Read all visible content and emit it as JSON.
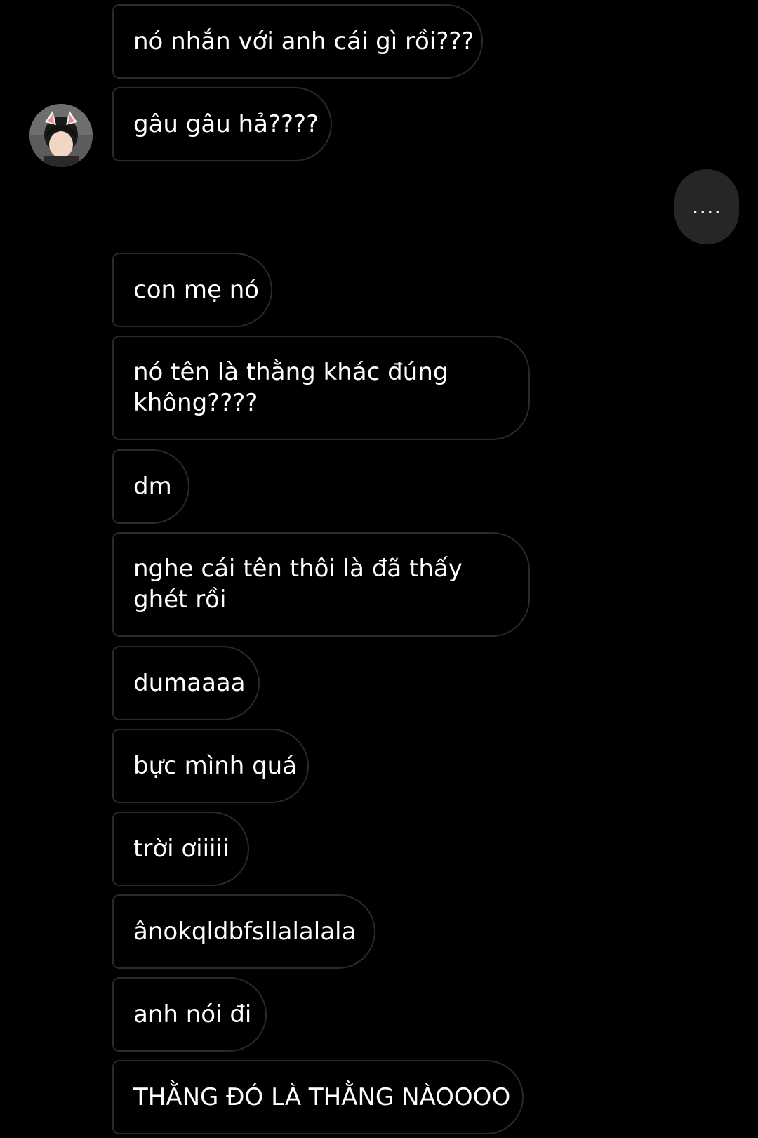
{
  "conversation": {
    "typing_indicator": "....",
    "messages": [
      {
        "text": "nó nhắn với anh cái gì rồi???"
      },
      {
        "text": "gâu gâu hả????"
      },
      {
        "text": "con mẹ nó"
      },
      {
        "text": "nó tên là thằng khác đúng không????"
      },
      {
        "text": "dm"
      },
      {
        "text": "nghe cái tên thôi là đã thấy ghét rồi"
      },
      {
        "text": "dumaaaa"
      },
      {
        "text": "bực mình quá"
      },
      {
        "text": "trời ơiiiii"
      },
      {
        "text": "ânokqldbfsllalalala"
      },
      {
        "text": "anh nói đi"
      },
      {
        "text": "THẰNG ĐÓ LÀ THẰNG NÀOOOO"
      }
    ]
  }
}
